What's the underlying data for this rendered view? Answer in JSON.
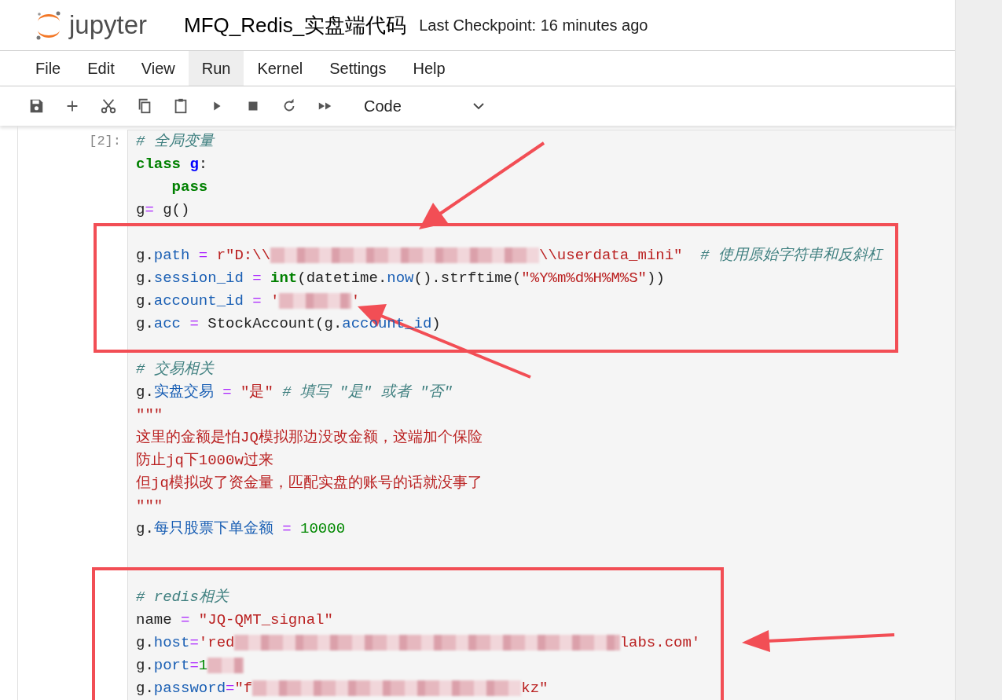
{
  "header": {
    "logo_text": "jupyter",
    "notebook_title": "MFQ_Redis_实盘端代码",
    "checkpoint": "Last Checkpoint: 16 minutes ago"
  },
  "menu": [
    {
      "label": "File",
      "selected": false
    },
    {
      "label": "Edit",
      "selected": false
    },
    {
      "label": "View",
      "selected": false
    },
    {
      "label": "Run",
      "selected": true
    },
    {
      "label": "Kernel",
      "selected": false
    },
    {
      "label": "Settings",
      "selected": false
    },
    {
      "label": "Help",
      "selected": false
    }
  ],
  "toolbar": {
    "buttons": [
      {
        "kind": "save"
      },
      {
        "kind": "add"
      },
      {
        "kind": "cut"
      },
      {
        "kind": "copy"
      },
      {
        "kind": "paste"
      },
      {
        "kind": "run"
      },
      {
        "kind": "stop"
      },
      {
        "kind": "restart"
      },
      {
        "kind": "run-all"
      }
    ],
    "cell_type": "Code"
  },
  "cell": {
    "prompt": "[2]:",
    "lines": [
      {
        "kind": "code",
        "tokens": [
          {
            "kind": "comment",
            "text": "# 全局变量"
          }
        ]
      },
      {
        "kind": "code",
        "tokens": [
          {
            "kind": "keyword",
            "text": "class"
          },
          {
            "kind": "def",
            "text": " g"
          },
          {
            "kind": "plain",
            "text": ":"
          }
        ]
      },
      {
        "kind": "code",
        "tokens": [
          {
            "kind": "keyword",
            "text": "    pass"
          }
        ]
      },
      {
        "kind": "code",
        "tokens": [
          {
            "kind": "plain",
            "text": "g"
          },
          {
            "kind": "operator",
            "text": "="
          },
          {
            "kind": "plain",
            "text": " g()"
          }
        ]
      },
      {
        "kind": "blank"
      },
      {
        "kind": "code",
        "tokens": [
          {
            "kind": "plain",
            "text": "g."
          },
          {
            "kind": "property",
            "text": "path"
          },
          {
            "kind": "operator",
            "text": " = "
          },
          {
            "kind": "string",
            "text": "r\"D:\\\\"
          },
          {
            "kind": "redacted-long"
          },
          {
            "kind": "string",
            "text": "\\\\userdata_mini\""
          },
          {
            "kind": "comment",
            "text": "  # 使用原始字符串和反斜杠"
          }
        ]
      },
      {
        "kind": "code",
        "tokens": [
          {
            "kind": "plain",
            "text": "g."
          },
          {
            "kind": "property",
            "text": "session_id"
          },
          {
            "kind": "operator",
            "text": " = "
          },
          {
            "kind": "builtin",
            "text": "int"
          },
          {
            "kind": "plain",
            "text": "(datetime."
          },
          {
            "kind": "property",
            "text": "now"
          },
          {
            "kind": "plain",
            "text": "().strftime("
          },
          {
            "kind": "string",
            "text": "\"%Y%m%d%H%M%S\""
          },
          {
            "kind": "plain",
            "text": "))"
          }
        ]
      },
      {
        "kind": "code",
        "tokens": [
          {
            "kind": "plain",
            "text": "g."
          },
          {
            "kind": "property",
            "text": "account_id"
          },
          {
            "kind": "operator",
            "text": " = "
          },
          {
            "kind": "string",
            "text": "'"
          },
          {
            "kind": "redacted-short"
          },
          {
            "kind": "string",
            "text": "'"
          }
        ]
      },
      {
        "kind": "code",
        "tokens": [
          {
            "kind": "plain",
            "text": "g."
          },
          {
            "kind": "property",
            "text": "acc"
          },
          {
            "kind": "operator",
            "text": " = "
          },
          {
            "kind": "plain",
            "text": "StockAccount(g."
          },
          {
            "kind": "property",
            "text": "account_id"
          },
          {
            "kind": "plain",
            "text": ")"
          }
        ]
      },
      {
        "kind": "blank"
      },
      {
        "kind": "code",
        "tokens": [
          {
            "kind": "comment",
            "text": "# 交易相关"
          }
        ]
      },
      {
        "kind": "code",
        "tokens": [
          {
            "kind": "plain",
            "text": "g."
          },
          {
            "kind": "property",
            "text": "实盘交易"
          },
          {
            "kind": "operator",
            "text": " = "
          },
          {
            "kind": "string",
            "text": "\"是\""
          },
          {
            "kind": "comment",
            "text": " # 填写 \"是\" 或者 \"否\""
          }
        ]
      },
      {
        "kind": "code",
        "tokens": [
          {
            "kind": "string",
            "text": "\"\"\""
          }
        ]
      },
      {
        "kind": "code",
        "tokens": [
          {
            "kind": "string",
            "text": "这里的金额是怕JQ模拟那边没改金额，这端加个保险"
          }
        ]
      },
      {
        "kind": "code",
        "tokens": [
          {
            "kind": "string",
            "text": "防止jq下1000w过来"
          }
        ]
      },
      {
        "kind": "code",
        "tokens": [
          {
            "kind": "string",
            "text": "但jq模拟改了资金量，匹配实盘的账号的话就没事了"
          }
        ]
      },
      {
        "kind": "code",
        "tokens": [
          {
            "kind": "string",
            "text": "\"\"\""
          }
        ]
      },
      {
        "kind": "code",
        "tokens": [
          {
            "kind": "plain",
            "text": "g."
          },
          {
            "kind": "property",
            "text": "每只股票下单金额"
          },
          {
            "kind": "operator",
            "text": " = "
          },
          {
            "kind": "number",
            "text": "10000"
          }
        ]
      },
      {
        "kind": "blank"
      },
      {
        "kind": "blank"
      },
      {
        "kind": "code",
        "tokens": [
          {
            "kind": "comment",
            "text": "# redis相关"
          }
        ]
      },
      {
        "kind": "code",
        "tokens": [
          {
            "kind": "plain",
            "text": "name"
          },
          {
            "kind": "operator",
            "text": " = "
          },
          {
            "kind": "string",
            "text": "\"JQ-QMT_signal\""
          }
        ]
      },
      {
        "kind": "code",
        "tokens": [
          {
            "kind": "plain",
            "text": "g."
          },
          {
            "kind": "property",
            "text": "host"
          },
          {
            "kind": "operator",
            "text": "="
          },
          {
            "kind": "string",
            "text": "'red"
          },
          {
            "kind": "redacted-xlong"
          },
          {
            "kind": "string",
            "text": "labs.com'"
          }
        ]
      },
      {
        "kind": "code",
        "tokens": [
          {
            "kind": "plain",
            "text": "g."
          },
          {
            "kind": "property",
            "text": "port"
          },
          {
            "kind": "operator",
            "text": "="
          },
          {
            "kind": "number",
            "text": "1"
          },
          {
            "kind": "redacted-tiny"
          }
        ]
      },
      {
        "kind": "code",
        "tokens": [
          {
            "kind": "plain",
            "text": "g."
          },
          {
            "kind": "property",
            "text": "password"
          },
          {
            "kind": "operator",
            "text": "="
          },
          {
            "kind": "string",
            "text": "\"f"
          },
          {
            "kind": "redacted-long"
          },
          {
            "kind": "string",
            "text": "kz\""
          }
        ]
      }
    ]
  }
}
